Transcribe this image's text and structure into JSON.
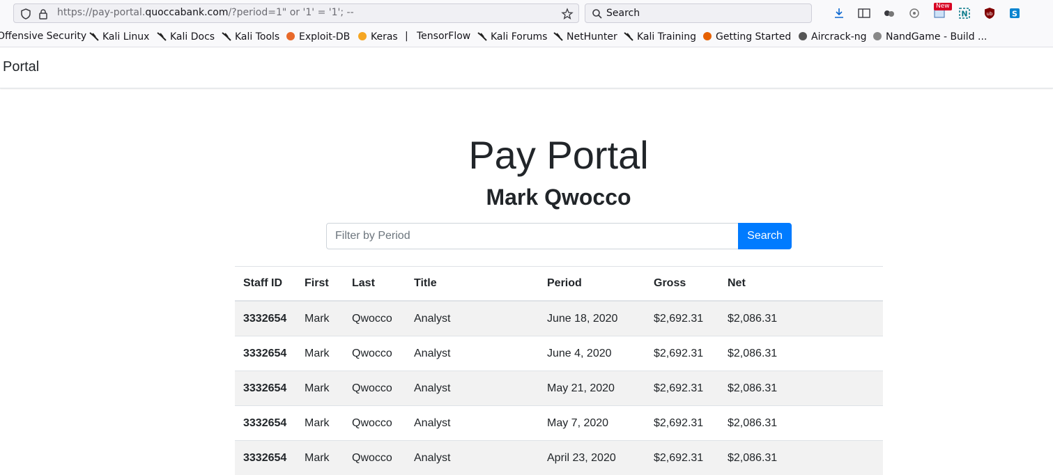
{
  "browser": {
    "url_prefix": "https://pay-portal.",
    "url_host": "quoccabank.com",
    "url_suffix": "/?period=1\" or '1' = '1'; --",
    "search_label": "Search",
    "new_badge": "New"
  },
  "bookmarks": [
    {
      "label": "Offensive Security",
      "icon": "kali-dragon-icon"
    },
    {
      "label": "Kali Linux",
      "icon": "kali-dragon-icon"
    },
    {
      "label": "Kali Docs",
      "icon": "kali-dragon-icon"
    },
    {
      "label": "Kali Tools",
      "icon": "kali-dragon-icon"
    },
    {
      "label": "Exploit-DB",
      "icon": "exploit-db-icon"
    },
    {
      "label": "Keras",
      "icon": "keras-icon"
    },
    {
      "label": "|",
      "icon": ""
    },
    {
      "label": "TensorFlow",
      "icon": ""
    },
    {
      "label": "Kali Forums",
      "icon": "kali-dragon-icon"
    },
    {
      "label": "NetHunter",
      "icon": "kali-dragon-icon"
    },
    {
      "label": "Kali Training",
      "icon": "kali-dragon-icon"
    },
    {
      "label": "Getting Started",
      "icon": "firefox-icon"
    },
    {
      "label": "Aircrack-ng",
      "icon": "aircrack-icon"
    },
    {
      "label": "NandGame - Build ...",
      "icon": "nandgame-icon"
    }
  ],
  "navbar": {
    "brand": "Portal"
  },
  "page": {
    "title": "Pay Portal",
    "user": "Mark Qwocco",
    "filter_placeholder": "Filter by Period",
    "search_button": "Search"
  },
  "table": {
    "headers": [
      "Staff ID",
      "First",
      "Last",
      "Title",
      "Period",
      "Gross",
      "Net"
    ],
    "rows": [
      [
        "3332654",
        "Mark",
        "Qwocco",
        "Analyst",
        "June 18, 2020",
        "$2,692.31",
        "$2,086.31"
      ],
      [
        "3332654",
        "Mark",
        "Qwocco",
        "Analyst",
        "June 4, 2020",
        "$2,692.31",
        "$2,086.31"
      ],
      [
        "3332654",
        "Mark",
        "Qwocco",
        "Analyst",
        "May 21, 2020",
        "$2,692.31",
        "$2,086.31"
      ],
      [
        "3332654",
        "Mark",
        "Qwocco",
        "Analyst",
        "May 7, 2020",
        "$2,692.31",
        "$2,086.31"
      ],
      [
        "3332654",
        "Mark",
        "Qwocco",
        "Analyst",
        "April 23, 2020",
        "$2,692.31",
        "$2,086.31"
      ]
    ]
  },
  "colors": {
    "primary": "#007bff",
    "stripe": "#f2f2f2",
    "text": "#212529"
  }
}
